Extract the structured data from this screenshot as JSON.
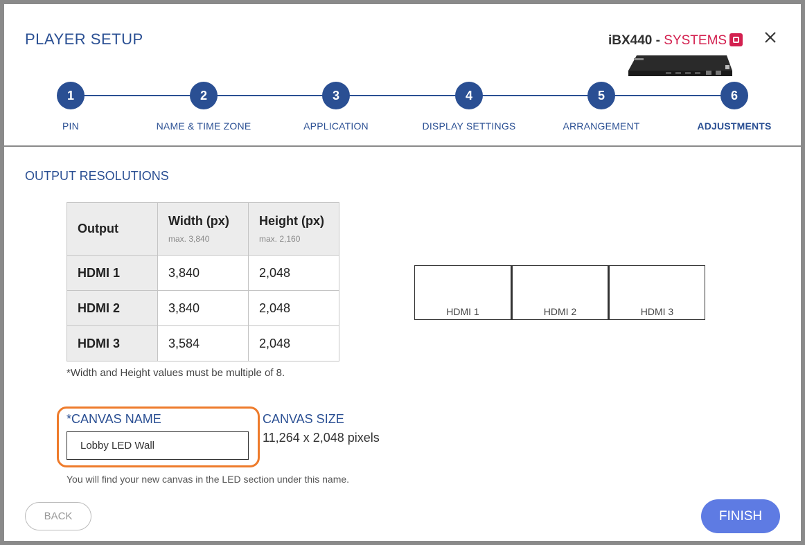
{
  "header": {
    "title": "PLAYER SETUP",
    "product_model": "iBX440 - ",
    "product_brand": "SYSTEMS",
    "close_icon": "close-icon",
    "brand_color": "#d3204f",
    "accent_color": "#2a4f93"
  },
  "steps": [
    {
      "number": "1",
      "label": "PIN"
    },
    {
      "number": "2",
      "label": "NAME & TIME ZONE"
    },
    {
      "number": "3",
      "label": "APPLICATION"
    },
    {
      "number": "4",
      "label": "DISPLAY SETTINGS"
    },
    {
      "number": "5",
      "label": "ARRANGEMENT"
    },
    {
      "number": "6",
      "label": "ADJUSTMENTS",
      "active": true
    }
  ],
  "output_resolutions": {
    "title": "OUTPUT RESOLUTIONS",
    "headers": {
      "output": "Output",
      "width": "Width (px)",
      "width_max": "max. 3,840",
      "height": "Height (px)",
      "height_max": "max. 2,160"
    },
    "rows": [
      {
        "output": "HDMI 1",
        "width": "3,840",
        "height": "2,048"
      },
      {
        "output": "HDMI 2",
        "width": "3,840",
        "height": "2,048"
      },
      {
        "output": "HDMI 3",
        "width": "3,584",
        "height": "2,048"
      }
    ],
    "note": "*Width and Height values must be multiple of 8."
  },
  "preview": {
    "boxes": [
      "HDMI 1",
      "HDMI 2",
      "HDMI 3"
    ]
  },
  "canvas": {
    "name_label": "*CANVAS NAME",
    "name_value": "Lobby LED Wall",
    "size_label": "CANVAS SIZE",
    "size_value": "11,264 x 2,048 pixels",
    "hint": "You will find your new canvas in the LED section under this name.",
    "highlight_color": "#ee7b2b"
  },
  "footer": {
    "back_label": "BACK",
    "finish_label": "FINISH",
    "finish_color": "#5e7be3"
  }
}
